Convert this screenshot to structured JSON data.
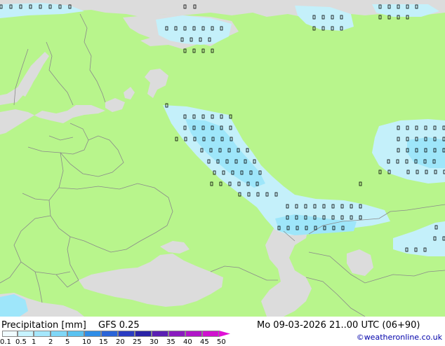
{
  "map": {
    "colors": {
      "sea": "#dcdcdc",
      "land": "#b8f58c",
      "precip_light": "#c4f0fa",
      "precip_medium": "#9ee6fa",
      "precip_heavy": "#78d2f5",
      "border": "#8a8a8a",
      "coast": "#6a6a6a",
      "marker": "#000000"
    }
  },
  "footer": {
    "title": "Precipitation [mm]",
    "model": "GFS 0.25",
    "date": "Mo 09-03-2026 21..00 UTC (06+90)",
    "credit": "©weatheronline.co.uk"
  },
  "legend": {
    "ticks": [
      "0.1",
      "0.5",
      "1",
      "2",
      "5",
      "10",
      "15",
      "20",
      "25",
      "30",
      "35",
      "40",
      "45",
      "50"
    ],
    "colors": [
      "#f0fbff",
      "#c7f3ff",
      "#a5e7fc",
      "#7fd7f7",
      "#5ac2f0",
      "#2f8de6",
      "#2a64d8",
      "#2a3cc2",
      "#2a23a6",
      "#5a1fb3",
      "#8a1bbf",
      "#b016c8",
      "#d012cf",
      "#e010d6"
    ]
  }
}
